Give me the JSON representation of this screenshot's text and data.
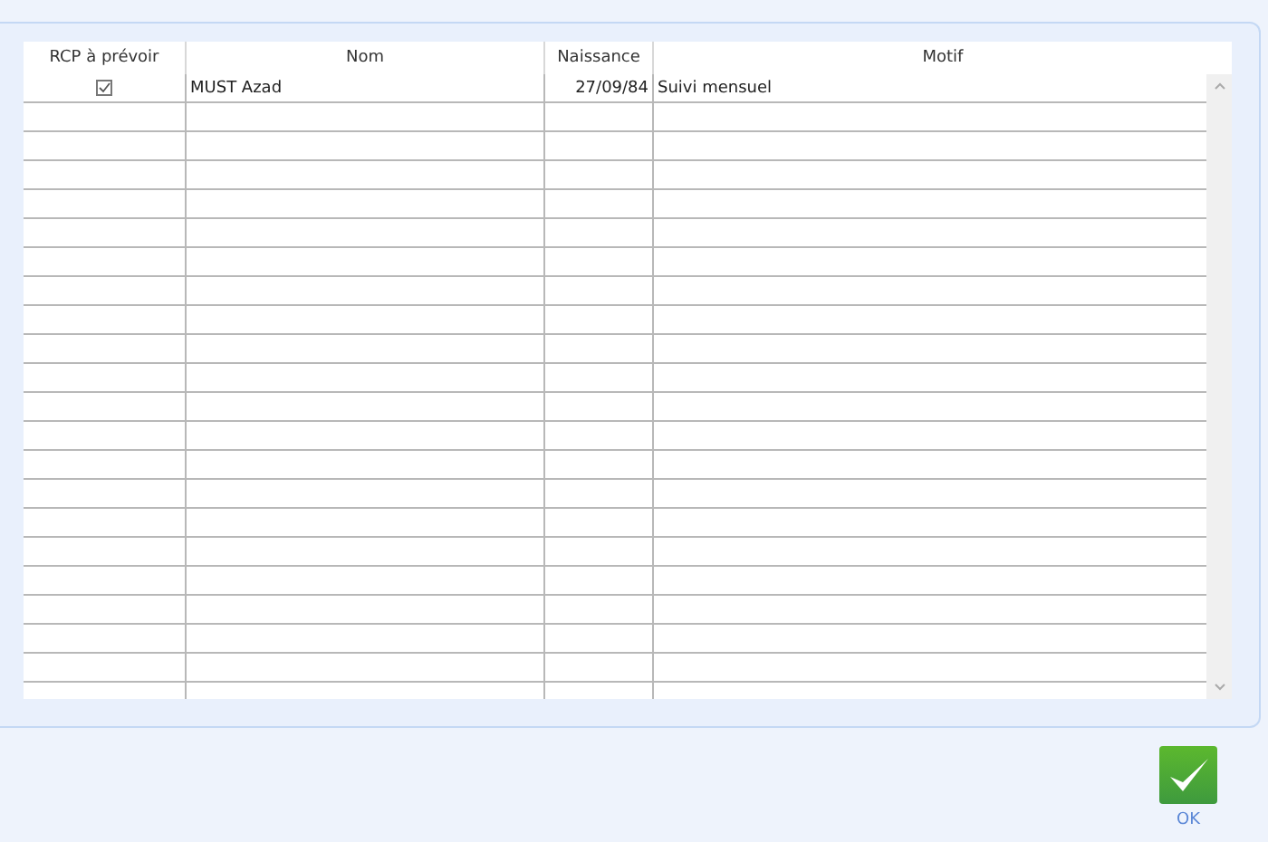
{
  "table": {
    "columns": [
      "RCP à prévoir",
      "Nom",
      "Naissance",
      "Motif"
    ],
    "rows": [
      {
        "checked": true,
        "nom": "MUST Azad",
        "naissance": "27/09/84",
        "motif": "Suivi mensuel"
      }
    ]
  },
  "ok_button": {
    "label": "OK"
  }
}
